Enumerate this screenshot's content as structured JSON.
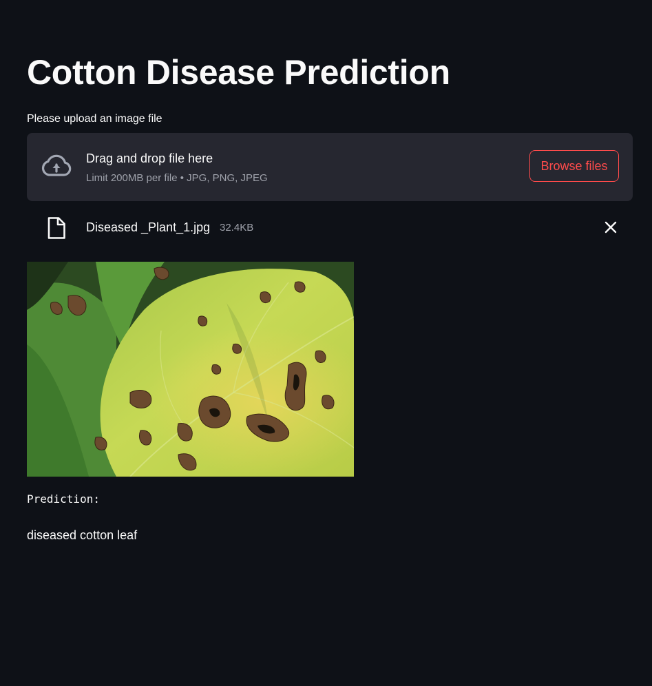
{
  "page": {
    "title": "Cotton Disease Prediction"
  },
  "uploader": {
    "label": "Please upload an image file",
    "drop_title": "Drag and drop file here",
    "drop_limit": "Limit 200MB per file • JPG, PNG, JPEG",
    "browse_label": "Browse files",
    "icon": "cloud-upload-icon"
  },
  "uploaded_file": {
    "name": "Diseased _Plant_1.jpg",
    "size": "32.4KB",
    "icon": "file-icon",
    "remove_icon": "close-icon"
  },
  "result": {
    "label": "Prediction:",
    "value": "diseased cotton leaf"
  },
  "colors": {
    "background": "#0e1117",
    "dropzone": "#262730",
    "accent": "#ff4b4b",
    "text": "#fafafa",
    "muted_text": "#9fa2ab"
  }
}
